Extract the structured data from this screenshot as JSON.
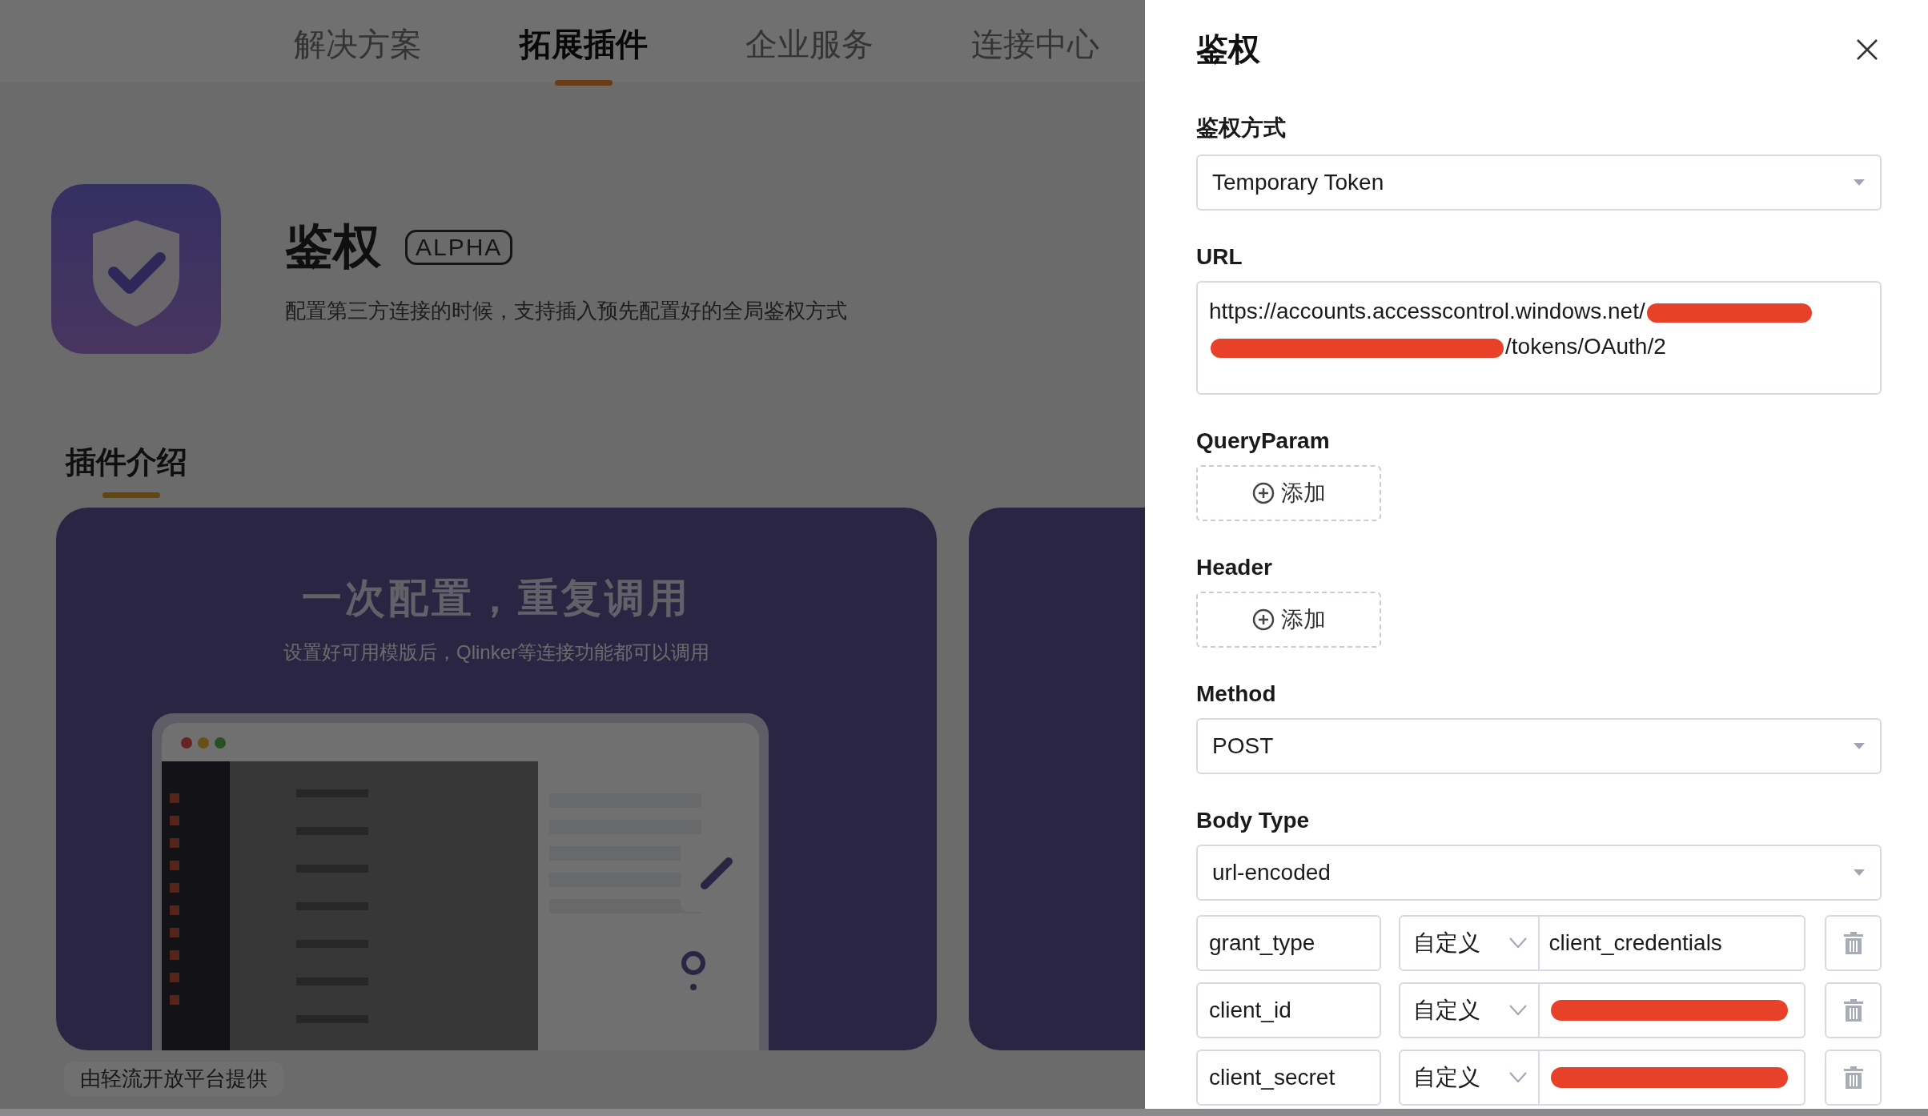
{
  "nav": {
    "tabs": [
      {
        "label": "解决方案",
        "selected": false
      },
      {
        "label": "拓展插件",
        "selected": true
      },
      {
        "label": "企业服务",
        "selected": false
      },
      {
        "label": "连接中心",
        "selected": false
      }
    ]
  },
  "plugin": {
    "title": "鉴权",
    "badge": "ALPHA",
    "description": "配置第三方连接的时候，支持插入预先配置好的全局鉴权方式"
  },
  "section": {
    "title": "插件介绍"
  },
  "banner": {
    "title": "一次配置，重复调用",
    "subtitle": "设置好可用模版后，Qlinker等连接功能都可以调用"
  },
  "footer": {
    "provider": "由轻流开放平台提供"
  },
  "drawer": {
    "title": "鉴权",
    "fields": [
      {
        "kind": "select",
        "label": "鉴权方式",
        "value": "Temporary Token"
      },
      {
        "kind": "url",
        "label": "URL",
        "segments": [
          {
            "kind": "text",
            "text": "https://accounts.accesscontrol.windows.net/"
          },
          {
            "kind": "redaction"
          },
          {
            "kind": "linebreak"
          },
          {
            "kind": "redaction"
          },
          {
            "kind": "text",
            "text": "/tokens/OAuth/2"
          }
        ]
      },
      {
        "kind": "add",
        "label": "QueryParam",
        "button": "添加"
      },
      {
        "kind": "add",
        "label": "Header",
        "button": "添加"
      },
      {
        "kind": "select",
        "label": "Method",
        "value": "POST"
      },
      {
        "kind": "select",
        "label": "Body Type",
        "value": "url-encoded"
      }
    ],
    "params": [
      {
        "key": "grant_type",
        "source": "自定义",
        "value": "client_credentials",
        "redacted": false
      },
      {
        "key": "client_id",
        "source": "自定义",
        "redacted": true
      },
      {
        "key": "client_secret",
        "source": "自定义",
        "redacted": true
      }
    ]
  }
}
